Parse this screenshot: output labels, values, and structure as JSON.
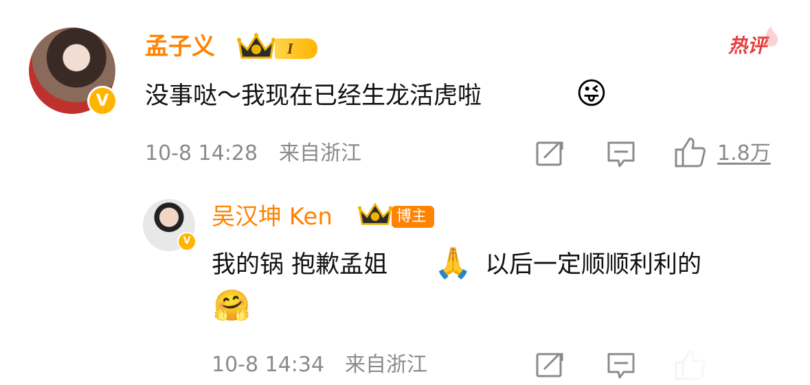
{
  "comment": {
    "author": "孟子义",
    "rank_badge": "I",
    "hot_label": "热评",
    "text": "没事哒～我现在已经生龙活虎啦",
    "emoji": "😜",
    "time": "10-8 14:28",
    "location": "来自浙江",
    "likes": "1.8万"
  },
  "reply": {
    "author": "吴汉坤 Ken",
    "role_badge": "博主",
    "text_part1": "我的锅 抱歉孟姐",
    "emoji_pray": "🙏",
    "text_part2": "以后一定顺顺利利的",
    "emoji_hug": "🤗",
    "time": "10-8 14:34",
    "location": "来自浙江"
  },
  "icons": {
    "verified": "v-badge-icon",
    "crown": "crown-icon",
    "share": "share-icon",
    "comment": "comment-icon",
    "like": "thumbs-up-icon"
  },
  "colors": {
    "name": "#ff8200",
    "hot": "#e83d3d",
    "meta": "#8a8a8a",
    "verified": "#ffb400"
  }
}
